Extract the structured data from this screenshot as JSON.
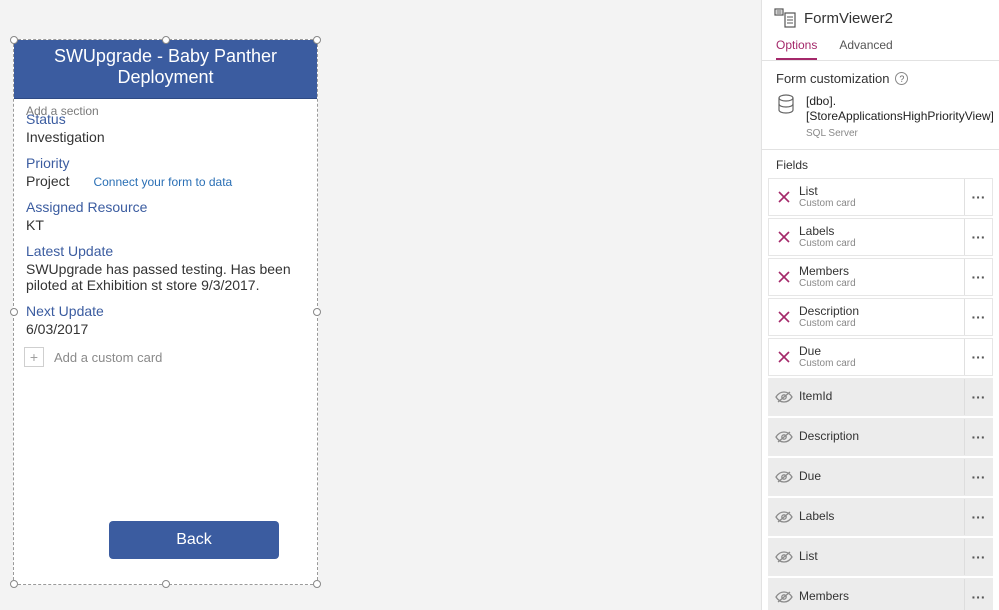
{
  "form": {
    "title": "SWUpgrade - Baby Panther Deployment",
    "section_ghost": "Add a section",
    "fields": {
      "status": {
        "label": "Status",
        "value": "Investigation"
      },
      "priority": {
        "label": "Priority",
        "value": "Project"
      },
      "assigned": {
        "label": "Assigned Resource",
        "value": "KT"
      },
      "latest": {
        "label": "Latest Update",
        "value": "SWUpgrade has passed testing. Has been piloted at Exhibition st store 9/3/2017."
      },
      "next": {
        "label": "Next Update",
        "value": "6/03/2017"
      }
    },
    "connect_link": "Connect your form to data",
    "add_card": "Add a custom card",
    "back_label": "Back"
  },
  "panel": {
    "title": "FormViewer2",
    "tabs": {
      "options": "Options",
      "advanced": "Advanced"
    },
    "customization_header": "Form customization",
    "datasource": {
      "line1": "[dbo].",
      "line2": "[StoreApplicationsHighPriorityView]",
      "sub": "SQL Server"
    },
    "fields_header": "Fields",
    "custom_card_sub": "Custom card",
    "field_items": [
      {
        "name": "List",
        "state": "removed"
      },
      {
        "name": "Labels",
        "state": "removed"
      },
      {
        "name": "Members",
        "state": "removed"
      },
      {
        "name": "Description",
        "state": "removed"
      },
      {
        "name": "Due",
        "state": "removed"
      },
      {
        "name": "ItemId",
        "state": "hidden"
      },
      {
        "name": "Description",
        "state": "hidden"
      },
      {
        "name": "Due",
        "state": "hidden"
      },
      {
        "name": "Labels",
        "state": "hidden"
      },
      {
        "name": "List",
        "state": "hidden"
      },
      {
        "name": "Members",
        "state": "hidden"
      }
    ]
  }
}
